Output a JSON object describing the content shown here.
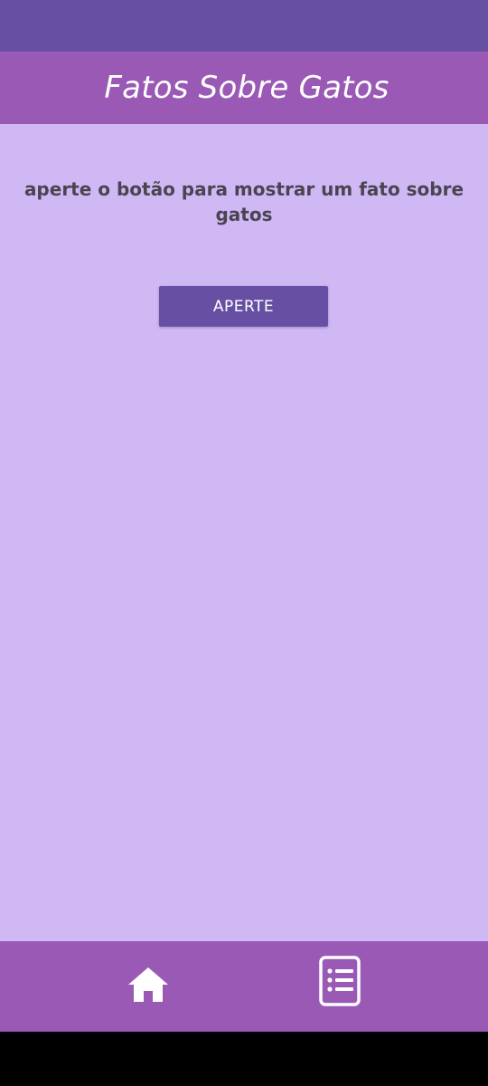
{
  "app_bar": {
    "title": "Fatos Sobre Gatos"
  },
  "main": {
    "prompt": "aperte o botão para mostrar um fato sobre gatos",
    "button_label": "APERTE"
  },
  "bottom_nav": {
    "items": [
      {
        "icon": "home-icon"
      },
      {
        "icon": "list-icon"
      }
    ]
  },
  "colors": {
    "status_bar": "#6750a4",
    "app_bar": "#9a59b5",
    "background": "#d0b8f5",
    "button": "#6750a4",
    "text": "#4a4451"
  }
}
